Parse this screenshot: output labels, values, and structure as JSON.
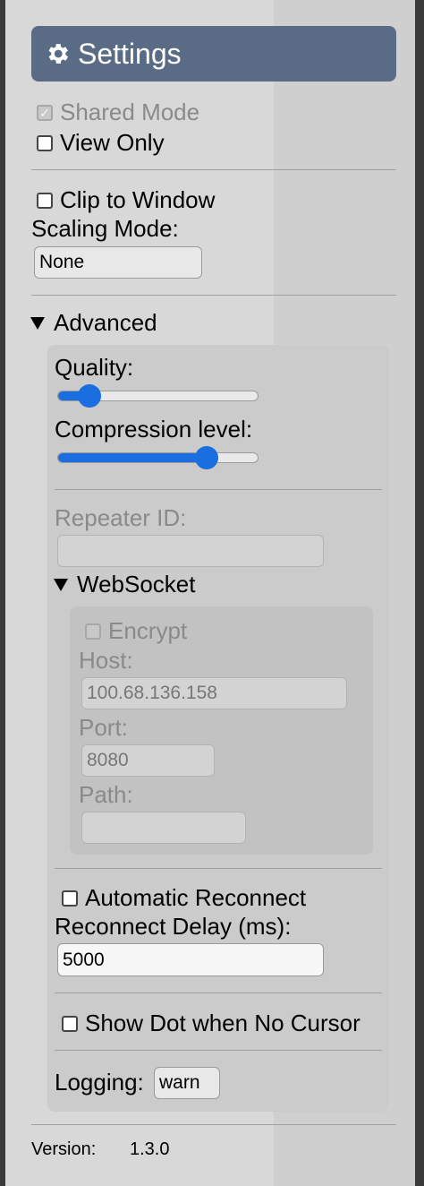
{
  "header": {
    "title": "Settings",
    "icon": "gear-icon"
  },
  "shared_mode": {
    "label": "Shared Mode",
    "checked": true,
    "disabled": true
  },
  "view_only": {
    "label": "View Only",
    "checked": false
  },
  "clip_to_window": {
    "label": "Clip to Window",
    "checked": false
  },
  "scaling_mode": {
    "label": "Scaling Mode:",
    "value": "None"
  },
  "advanced": {
    "label": "Advanced",
    "quality": {
      "label": "Quality:",
      "level": 0.13
    },
    "compression": {
      "label": "Compression level:",
      "level": 0.75
    },
    "repeater_id": {
      "label": "Repeater ID:",
      "value": ""
    },
    "websocket": {
      "label": "WebSocket",
      "encrypt": {
        "label": "Encrypt",
        "checked": false,
        "disabled": true
      },
      "host": {
        "label": "Host:",
        "value": "100.68.136.158"
      },
      "port": {
        "label": "Port:",
        "value": "8080"
      },
      "path": {
        "label": "Path:",
        "value": ""
      }
    },
    "auto_reconnect": {
      "label": "Automatic Reconnect",
      "checked": false
    },
    "reconnect_delay": {
      "label": "Reconnect Delay (ms):",
      "value": "5000"
    },
    "show_dot": {
      "label": "Show Dot when No Cursor",
      "checked": false
    },
    "logging": {
      "label": "Logging:",
      "value": "warn"
    }
  },
  "version": {
    "label": "Version:",
    "value": "1.3.0"
  },
  "colors": {
    "header_bg": "#5a6b85",
    "slider_accent": "#1a6ee0"
  }
}
